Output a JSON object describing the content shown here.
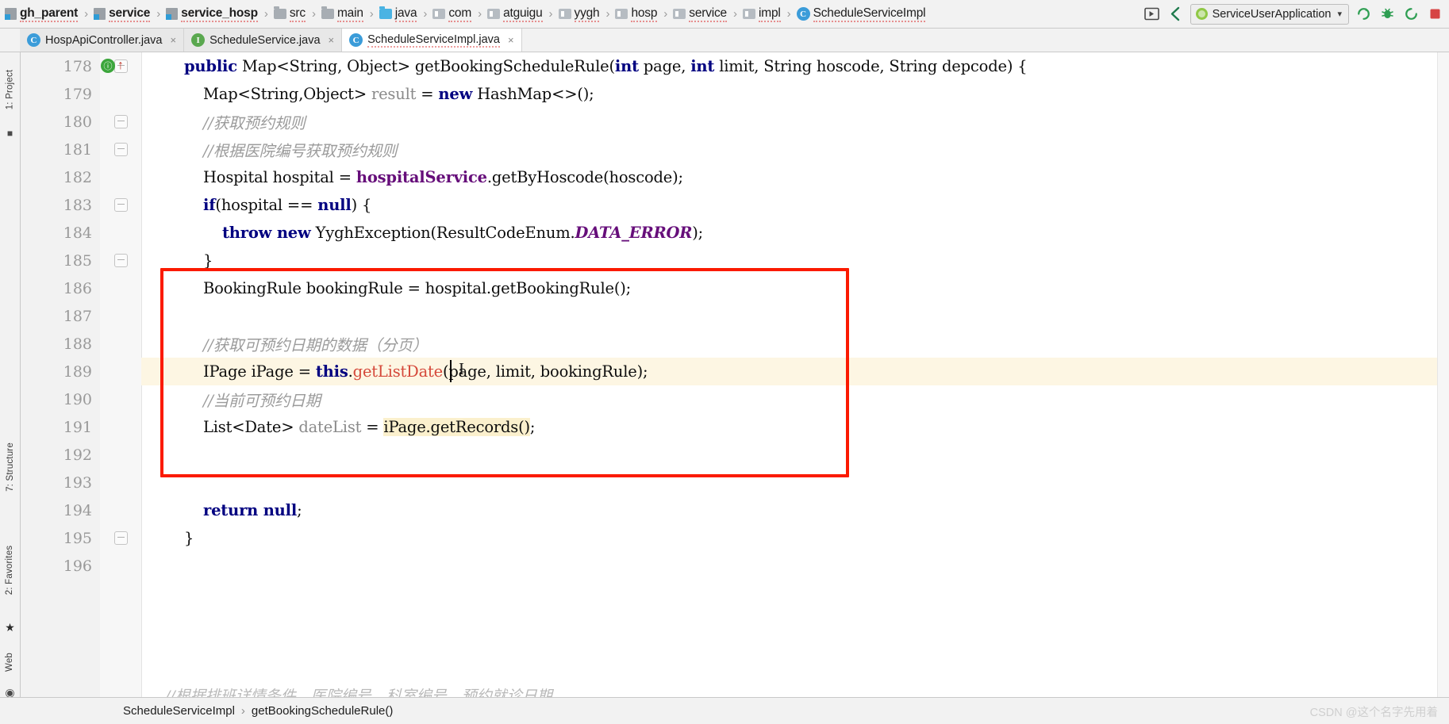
{
  "window": {
    "breadcrumb": [
      {
        "label": "gh_parent",
        "icon": "module-icon",
        "bold": true
      },
      {
        "label": "service",
        "icon": "module-icon",
        "bold": true
      },
      {
        "label": "service_hosp",
        "icon": "module-icon",
        "bold": true
      },
      {
        "label": "src",
        "icon": "folder-icon",
        "bold": false
      },
      {
        "label": "main",
        "icon": "folder-icon",
        "bold": false
      },
      {
        "label": "java",
        "icon": "source-folder-icon",
        "bold": false
      },
      {
        "label": "com",
        "icon": "package-icon",
        "bold": false
      },
      {
        "label": "atguigu",
        "icon": "package-icon",
        "bold": false
      },
      {
        "label": "yygh",
        "icon": "package-icon",
        "bold": false
      },
      {
        "label": "hosp",
        "icon": "package-icon",
        "bold": false
      },
      {
        "label": "service",
        "icon": "package-icon",
        "bold": false
      },
      {
        "label": "impl",
        "icon": "package-icon",
        "bold": false
      },
      {
        "label": "ScheduleServiceImpl",
        "icon": "java-class-icon",
        "bold": false
      }
    ],
    "separator": "›",
    "toolbar": {
      "preview_icon": "preview-layout-icon",
      "back_icon": "back-arrow-icon",
      "run_config_name": "ServiceUserApplication",
      "run_config_icon": "spring-boot-icon",
      "dropdown_icon": "chevron-down-icon",
      "run_icon": "run-icon",
      "debug_icon": "debug-icon",
      "rerun_icon": "rerun-icon",
      "stop_icon": "stop-icon"
    }
  },
  "tabs": [
    {
      "label": "HospApiController.java",
      "icon": "java-class-icon",
      "icon_letter": "C",
      "icon_kind": "class",
      "active": false,
      "close": "×"
    },
    {
      "label": "ScheduleService.java",
      "icon": "java-interface-icon",
      "icon_letter": "I",
      "icon_kind": "interface",
      "active": false,
      "close": "×"
    },
    {
      "label": "ScheduleServiceImpl.java",
      "icon": "java-class-icon",
      "icon_letter": "C",
      "icon_kind": "class",
      "active": true,
      "close": "×"
    }
  ],
  "tool_windows": {
    "left_top": "1: Project",
    "left_mid": "7: Structure",
    "left_bottom": "2: Favorites",
    "left_web": "Web"
  },
  "editor": {
    "first_line_number": 178,
    "caret_line_number": 189,
    "gutter": {
      "run_marker": "ⓘ",
      "implements_marker": "↑"
    },
    "lines": [
      {
        "num": 178,
        "fold": "expanded",
        "marker": "run",
        "html": "    <span class=\"kw\">public</span> <span class=\"plain\">Map&lt;String, Object&gt; getBookingScheduleRule(</span><span class=\"kw\">int</span><span class=\"plain\"> page, </span><span class=\"kw\">int</span><span class=\"plain\"> limit, String hoscode, String depcode) {</span>",
        "text": "public Map<String, Object> getBookingScheduleRule(int page, int limit, String hoscode, String depcode) {"
      },
      {
        "num": 179,
        "fold": "",
        "marker": "",
        "html": "        <span class=\"plain\">Map&lt;String,Object&gt; </span><span class=\"loc\">result</span><span class=\"plain\"> = </span><span class=\"kw\">new</span><span class=\"plain\"> HashMap&lt;&gt;();</span>",
        "text": "Map<String,Object> result = new HashMap<>();"
      },
      {
        "num": 180,
        "fold": "expanded",
        "marker": "",
        "html": "        <span class=\"cmt\">//获取预约规则</span>",
        "text": "//获取预约规则"
      },
      {
        "num": 181,
        "fold": "collapsed",
        "marker": "",
        "html": "        <span class=\"cmt\">//根据医院编号获取预约规则</span>",
        "text": "//根据医院编号获取预约规则"
      },
      {
        "num": 182,
        "fold": "",
        "marker": "",
        "html": "        <span class=\"plain\">Hospital hospital = </span><span class=\"fld\">hospitalService</span><span class=\"plain\">.getByHoscode(hoscode);</span>",
        "text": "Hospital hospital = hospitalService.getByHoscode(hoscode);"
      },
      {
        "num": 183,
        "fold": "expanded",
        "marker": "",
        "html": "        <span class=\"kw\">if</span><span class=\"plain\">(hospital == </span><span class=\"kw\">null</span><span class=\"plain\">) {</span>",
        "text": "if(hospital == null) {"
      },
      {
        "num": 184,
        "fold": "",
        "marker": "",
        "html": "            <span class=\"kw\">throw new</span><span class=\"plain\"> YyghException(ResultCodeEnum.</span><span class=\"stc\">DATA_ERROR</span><span class=\"plain\">);</span>",
        "text": "throw new YyghException(ResultCodeEnum.DATA_ERROR);"
      },
      {
        "num": 185,
        "fold": "endbrace",
        "marker": "",
        "html": "        <span class=\"plain\">}</span>",
        "text": "}"
      },
      {
        "num": 186,
        "fold": "",
        "marker": "",
        "html": "        <span class=\"plain\">BookingRule bookingRule = hospital.getBookingRule();</span>",
        "text": "BookingRule bookingRule = hospital.getBookingRule();"
      },
      {
        "num": 187,
        "fold": "",
        "marker": "",
        "html": "",
        "text": ""
      },
      {
        "num": 188,
        "fold": "",
        "marker": "",
        "html": "        <span class=\"cmt\">//获取可预约日期的数据（分页）</span>",
        "text": "//获取可预约日期的数据（分页）"
      },
      {
        "num": 189,
        "fold": "",
        "marker": "",
        "caret": true,
        "html": "        <span class=\"plain\">IPage iPage = </span><span class=\"kw\">this</span><span class=\"plain\">.</span><span class=\"err\">getListDate</span><span class=\"plain\">(page, limit, bookingRule);</span>",
        "text": "IPage iPage = this.getListDate(page, limit, bookingRule);"
      },
      {
        "num": 190,
        "fold": "",
        "marker": "",
        "html": "        <span class=\"cmt\">//当前可预约日期</span>",
        "text": "//当前可预约日期"
      },
      {
        "num": 191,
        "fold": "",
        "marker": "",
        "html": "        <span class=\"plain\">List&lt;Date&gt; </span><span class=\"loc\">dateList</span><span class=\"plain\"> = </span><span class=\"hlident\">iPage.getRecords()</span><span class=\"plain\">;</span>",
        "text": "List<Date> dateList = iPage.getRecords();"
      },
      {
        "num": 192,
        "fold": "",
        "marker": "",
        "html": "",
        "text": ""
      },
      {
        "num": 193,
        "fold": "",
        "marker": "",
        "html": "",
        "text": ""
      },
      {
        "num": 194,
        "fold": "",
        "marker": "",
        "html": "        <span class=\"kw\">return null</span><span class=\"plain\">;</span>",
        "text": "return null;"
      },
      {
        "num": 195,
        "fold": "endbrace",
        "marker": "",
        "html": "    <span class=\"plain\">}</span>",
        "text": "}"
      },
      {
        "num": 196,
        "fold": "",
        "marker": "",
        "html": "",
        "text": ""
      }
    ],
    "ghost_line_text": "//根据排班详情条件，医院编号，科室编号，预约就诊日期",
    "annotation": {
      "color": "#fb1a00",
      "shape": "rectangle"
    }
  },
  "status_bar": {
    "breadcrumb_class": "ScheduleServiceImpl",
    "breadcrumb_sep": "›",
    "breadcrumb_method": "getBookingScheduleRule()"
  },
  "watermark": "CSDN @这个名字先用着",
  "colors": {
    "accent_red": "#fb1a00",
    "keyword_blue": "#000080",
    "comment_grey": "#9b9b9b",
    "error_red": "#d5483a",
    "field_purple": "#660e7a",
    "caret_line_bg": "#fdf6e3",
    "highlight_bg": "#fbf0cd"
  }
}
